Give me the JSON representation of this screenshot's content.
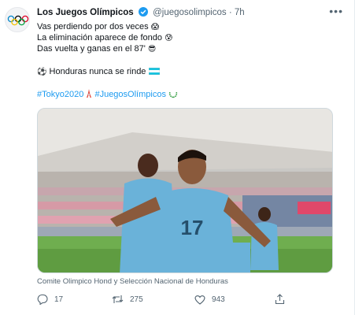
{
  "account": {
    "name": "Los Juegos Olímpicos",
    "handle": "@juegosolimpicos",
    "separator": "·",
    "time": "7h",
    "avatar_icon": "olympic-rings-icon",
    "verified_color": "#1d9bf0"
  },
  "tweet": {
    "line1": "Vas perdiendo por dos veces",
    "line1_emoji": "😱",
    "line2": "La eliminación aparece de fondo",
    "line2_emoji": "😰",
    "line3": "Das vuelta y ganas en el 87'",
    "line3_emoji": "😎",
    "line4_emoji": "⚽",
    "line4": "Honduras nunca se rinde",
    "line4_flag_icon": "honduras-flag-icon",
    "hashtag1": "#Tokyo2020",
    "hashtag1_icon": "tokyo-tower-icon",
    "hashtag2": "#JuegosOlímpicos",
    "hashtag2_icon": "laurel-wreath-icon"
  },
  "media": {
    "caption": "Comite Olimpico Hond y Selección Nacional de Honduras",
    "jersey_number": "17"
  },
  "actions": {
    "replies": "17",
    "retweets": "275",
    "likes": "943"
  },
  "colors": {
    "link": "#1d9bf0",
    "muted": "#536471",
    "jersey": "#6ab2d9"
  }
}
